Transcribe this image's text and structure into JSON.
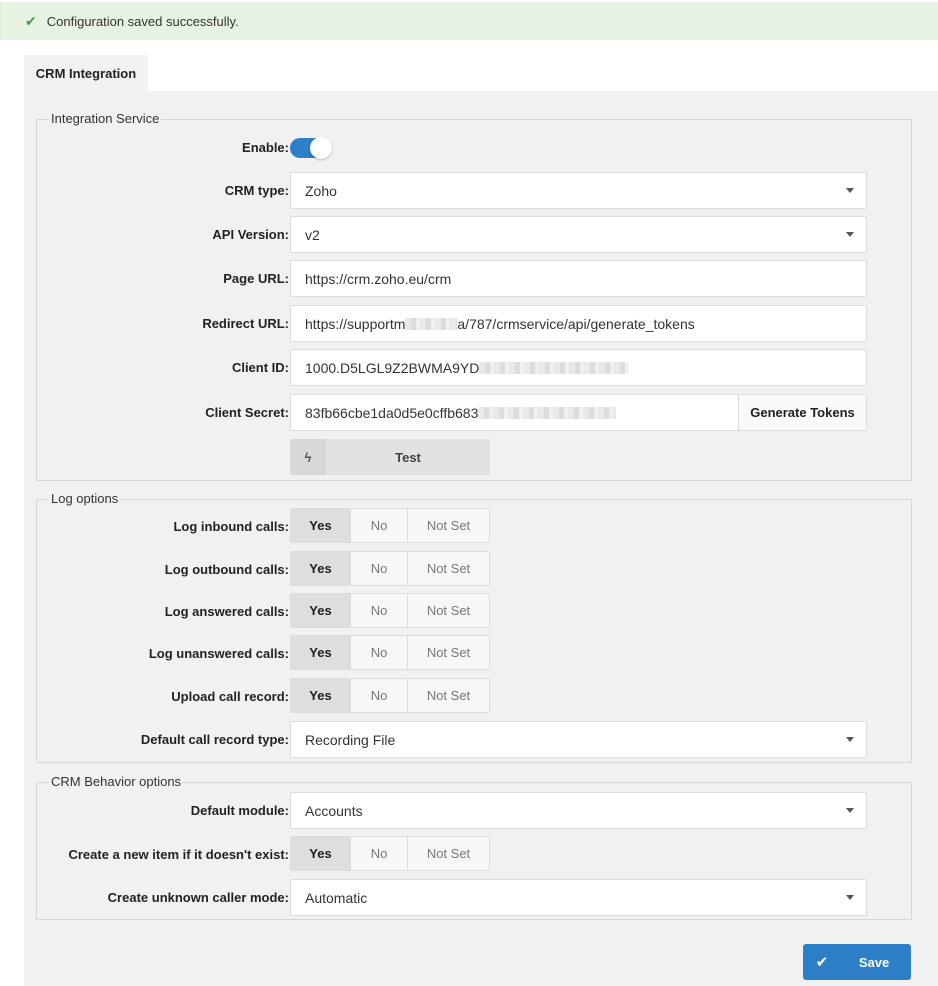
{
  "alert": {
    "icon": "check-icon",
    "message": "Configuration saved successfully."
  },
  "tabs": [
    {
      "label": "CRM Integration",
      "active": true
    }
  ],
  "integration_service": {
    "legend": "Integration Service",
    "enable_label": "Enable:",
    "enabled": true,
    "crm_type_label": "CRM type:",
    "crm_type_value": "Zoho",
    "api_version_label": "API Version:",
    "api_version_value": "v2",
    "page_url_label": "Page URL:",
    "page_url_value": "https://crm.zoho.eu/crm",
    "redirect_url_label": "Redirect URL:",
    "redirect_url_prefix": "https://supportm",
    "redirect_url_suffix": "a/787/crmservice/api/generate_tokens",
    "client_id_label": "Client ID:",
    "client_id_value": "1000.D5LGL9Z2BWMA9YD",
    "client_secret_label": "Client Secret:",
    "client_secret_value": "83fb66cbe1da0d5e0cffb683",
    "generate_tokens_label": "Generate Tokens",
    "test_label": "Test"
  },
  "log_options": {
    "legend": "Log options",
    "segment_labels": {
      "yes": "Yes",
      "no": "No",
      "not_set": "Not Set"
    },
    "rows": [
      {
        "label": "Log inbound calls:",
        "selected": "Yes"
      },
      {
        "label": "Log outbound calls:",
        "selected": "Yes"
      },
      {
        "label": "Log answered calls:",
        "selected": "Yes"
      },
      {
        "label": "Log unanswered calls:",
        "selected": "Yes"
      },
      {
        "label": "Upload call record:",
        "selected": "Yes"
      }
    ],
    "default_record_type_label": "Default call record type:",
    "default_record_type_value": "Recording File"
  },
  "crm_behavior": {
    "legend": "CRM Behavior options",
    "default_module_label": "Default module:",
    "default_module_value": "Accounts",
    "create_new_label": "Create a new item if it doesn't exist:",
    "create_new_selected": "Yes",
    "unknown_caller_label": "Create unknown caller mode:",
    "unknown_caller_value": "Automatic"
  },
  "save_label": "Save",
  "colors": {
    "primary": "#2d7fc8",
    "success_bg": "#e7f3e2",
    "success_icon": "#3aa04a",
    "panel_bg": "#f1f1f1"
  }
}
